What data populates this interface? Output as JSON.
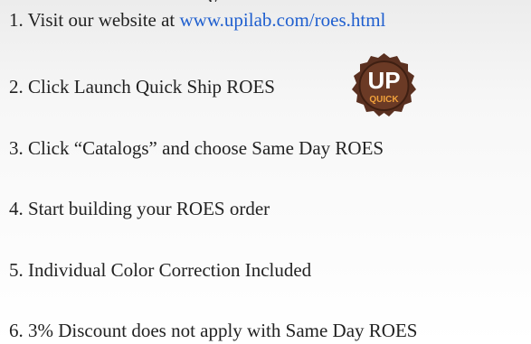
{
  "header_fragment": "y",
  "steps": [
    {
      "number": "1.",
      "text": "Visit our website at",
      "link": "www.upilab.com/roes.html"
    },
    {
      "number": "2.",
      "text": "Click Launch Quick Ship ROES"
    },
    {
      "number": "3.",
      "text": "Click “Catalogs” and choose Same Day ROES"
    },
    {
      "number": "4.",
      "text": "Start building your ROES order"
    },
    {
      "number": "5.",
      "text": "Individual Color Correction Included"
    },
    {
      "number": "6.",
      "text": "3% Discount does not apply with Same Day ROES"
    }
  ],
  "badge": {
    "line1": "UP",
    "line2": "QUICK",
    "icon": "up-quick-badge-icon",
    "colors": {
      "outer": "#5a3020",
      "inner": "#6b3a25",
      "text": "#ffffff",
      "accent": "#f2a23b"
    }
  },
  "colors": {
    "link": "#1f5fcf",
    "text": "#222222"
  }
}
